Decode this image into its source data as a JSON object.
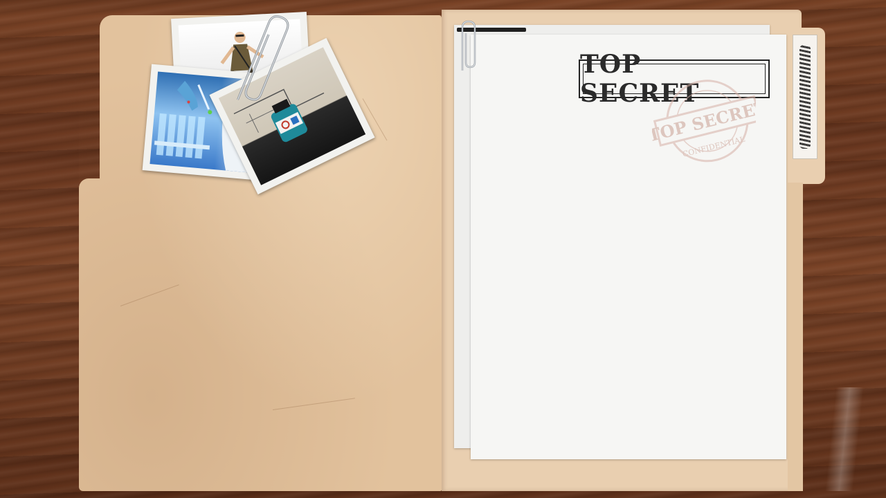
{
  "scene": "case file folder",
  "document": {
    "stamp_label": "TOP SECRET",
    "seal_text_top": "TOP SECRET",
    "seal_text_bottom": "CONFIDENTIAL"
  },
  "photos": [
    {
      "subject": "agent"
    },
    {
      "subject": "lab scientist with test tubes"
    },
    {
      "subject": "biohazard vial"
    }
  ],
  "colors": {
    "desk": "#6b3820",
    "folder": "#e2c29d",
    "paper": "#f6f6f4",
    "stamp_ink": "#2a2a2a",
    "seal_ink": "#c79c8f"
  },
  "icons": [
    "paperclip-icon",
    "biohazard-icon"
  ]
}
